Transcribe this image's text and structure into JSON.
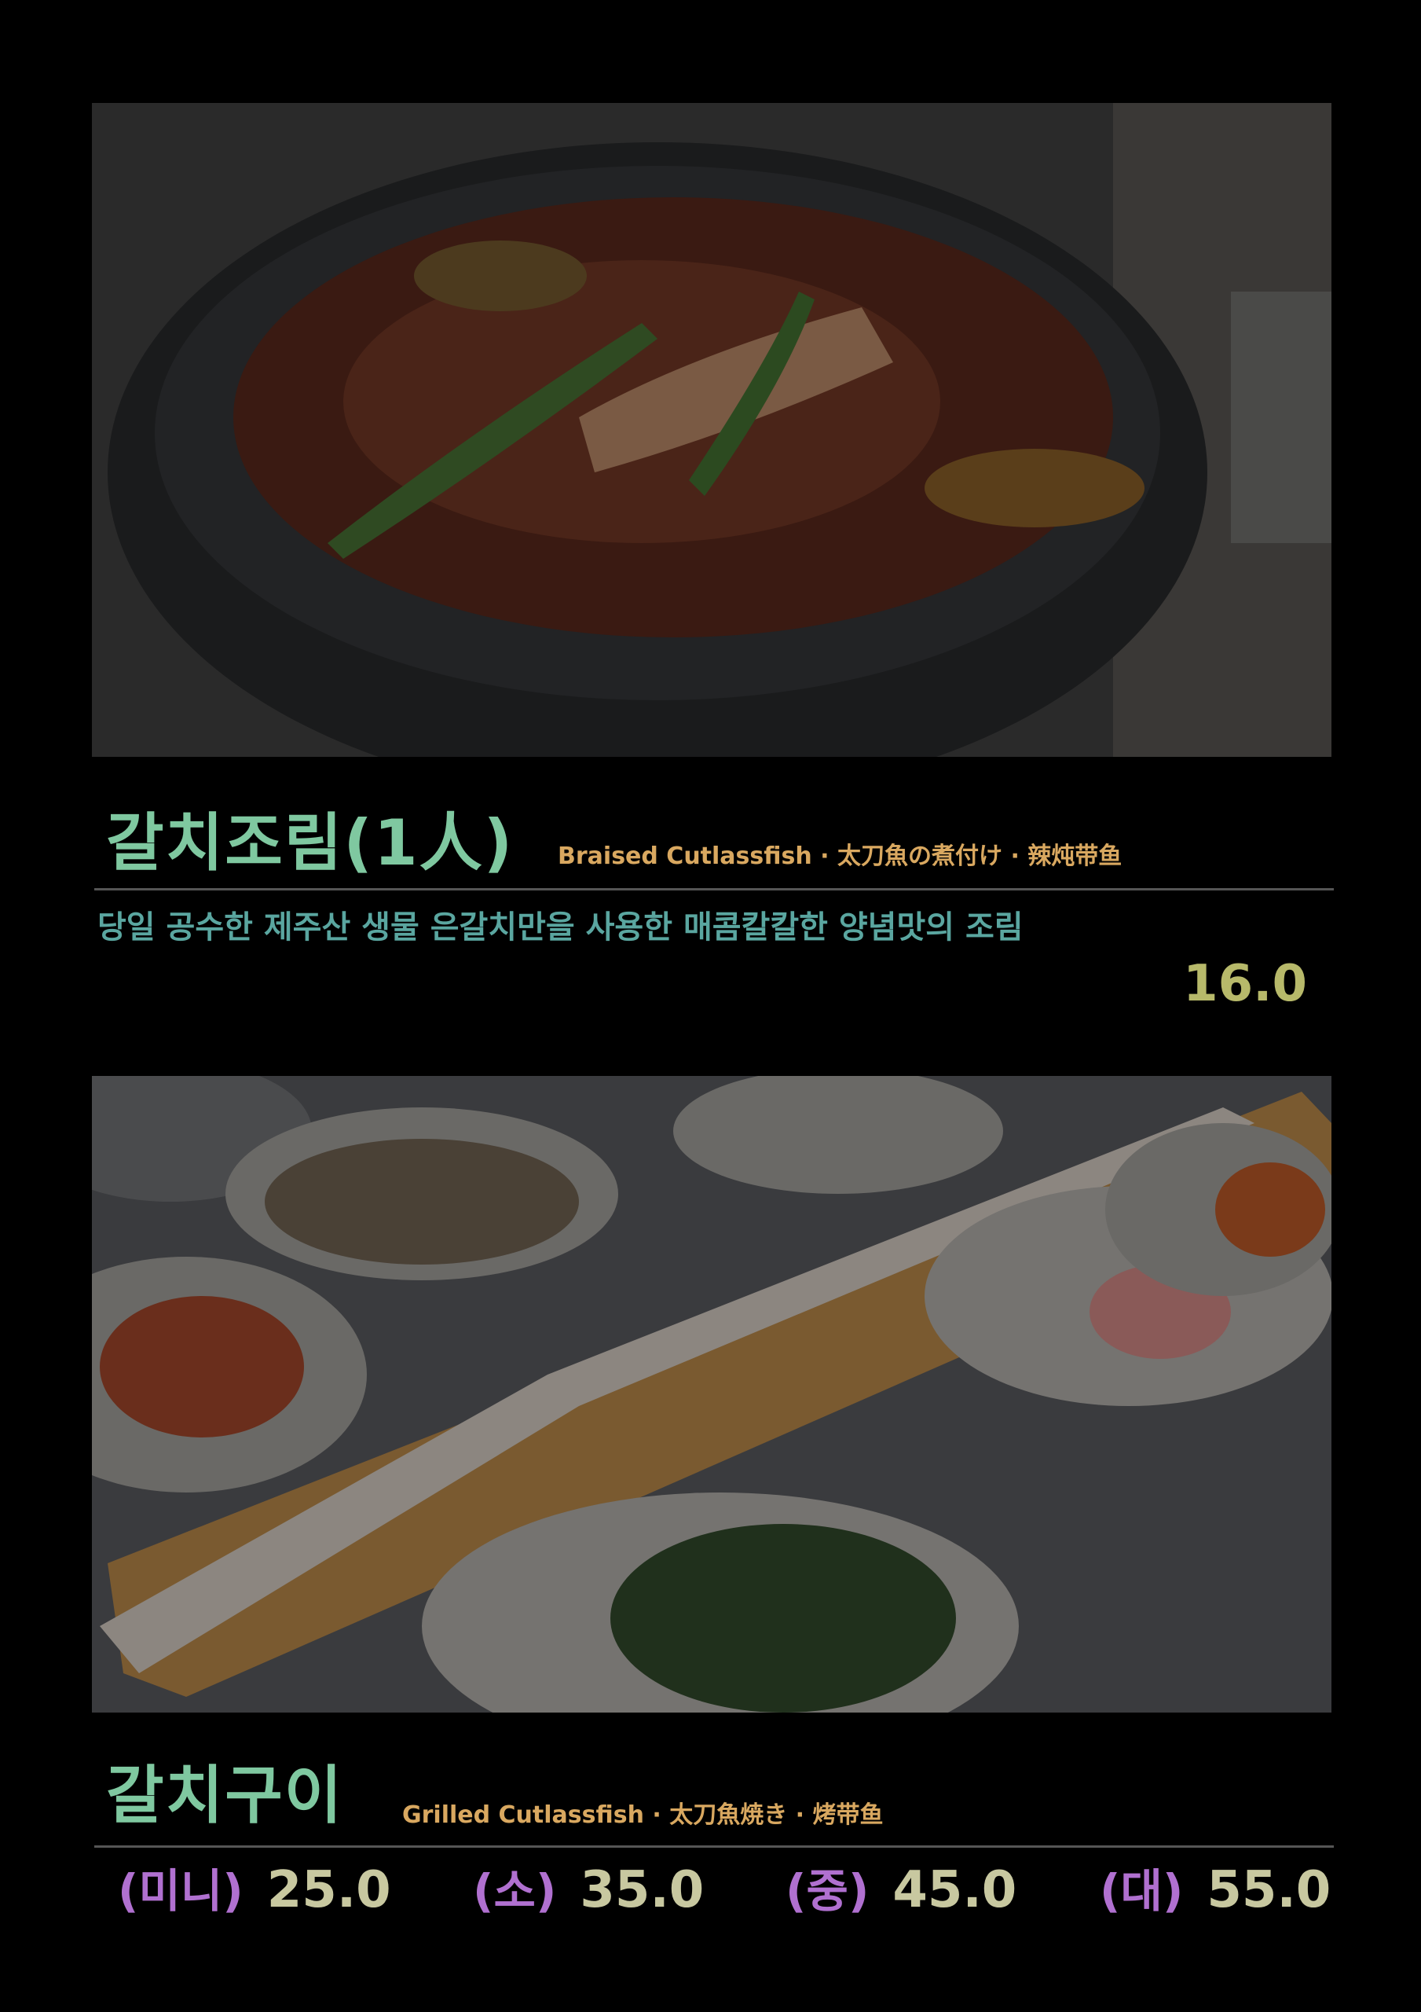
{
  "items": [
    {
      "title": "갈치조림(1人)",
      "subtitle": "Braised Cutlassfish · 太刀魚の煮付け · 辣炖带鱼",
      "description": "당일 공수한 제주산 생물 은갈치만을 사용한 매콤칼칼한 양념맛의 조림",
      "price": "16.0"
    },
    {
      "title": "갈치구이",
      "subtitle": "Grilled Cutlassfish · 太刀魚焼き · 烤带鱼",
      "sizes": [
        {
          "label": "(미니)",
          "price": "25.0"
        },
        {
          "label": "(소)",
          "price": "35.0"
        },
        {
          "label": "(중)",
          "price": "45.0"
        },
        {
          "label": "(대)",
          "price": "55.0"
        }
      ]
    }
  ]
}
